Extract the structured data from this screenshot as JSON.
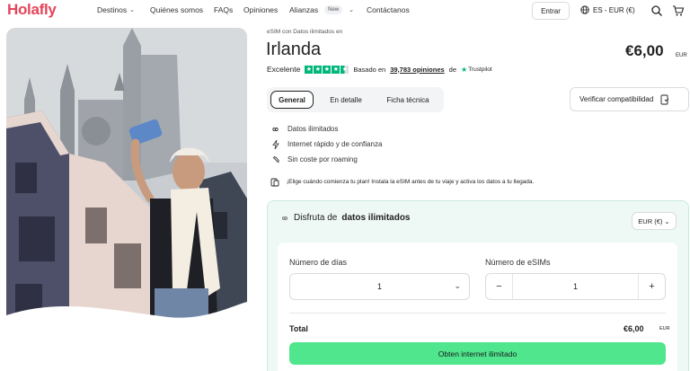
{
  "brand": {
    "logo": "Holafly",
    "accent": "#e5455a",
    "green": "#4fe68e"
  },
  "nav": {
    "items": [
      {
        "label": "Destinos",
        "has_chevron": true
      },
      {
        "label": "Quiénes somos"
      },
      {
        "label": "FAQs"
      },
      {
        "label": "Opiniones"
      },
      {
        "label": "Alianzas",
        "badge": "New",
        "has_chevron": true
      },
      {
        "label": "Contáctanos"
      }
    ],
    "login_label": "Entrar",
    "locale_label": "ES - EUR (€)",
    "icons": [
      "globe-icon",
      "search-icon",
      "cart-icon"
    ]
  },
  "product": {
    "subtitle": "eSIM con Datos ilimitados en",
    "title": "Irlanda",
    "price": "€6,00",
    "price_currency": "EUR",
    "rating": {
      "label": "Excelente",
      "stars": 4.5,
      "based_on": "Basado en",
      "reviews_link": "39,783 opiniones",
      "by": "de",
      "provider": "Trustpilot"
    },
    "tabs": [
      {
        "label": "General",
        "active": true
      },
      {
        "label": "En detalle"
      },
      {
        "label": "Ficha técnica"
      }
    ],
    "verify_label": "Verificar compatibilidad",
    "features": [
      {
        "icon": "infinity-icon",
        "label": "Datos ilimitados"
      },
      {
        "icon": "lightning-icon",
        "label": "Internet rápido y de confianza"
      },
      {
        "icon": "no-roaming-icon",
        "label": "Sin coste por roaming"
      }
    ],
    "notice": "¡Elige cuándo comienza tu plan! Instala la eSIM antes de tu viaje y activa los datos a tu llegada."
  },
  "plan": {
    "heading_prefix": "Disfruta de",
    "heading_bold": "datos ilimitados",
    "currency_select": "EUR (€)",
    "days_label": "Número de días",
    "days_value": "1",
    "esims_label": "Número de eSIMs",
    "esims_value": "1",
    "minus": "−",
    "plus": "+",
    "total_label": "Total",
    "total_value": "€6,00",
    "total_currency": "EUR",
    "cta_label": "Obten internet ilimitado"
  }
}
